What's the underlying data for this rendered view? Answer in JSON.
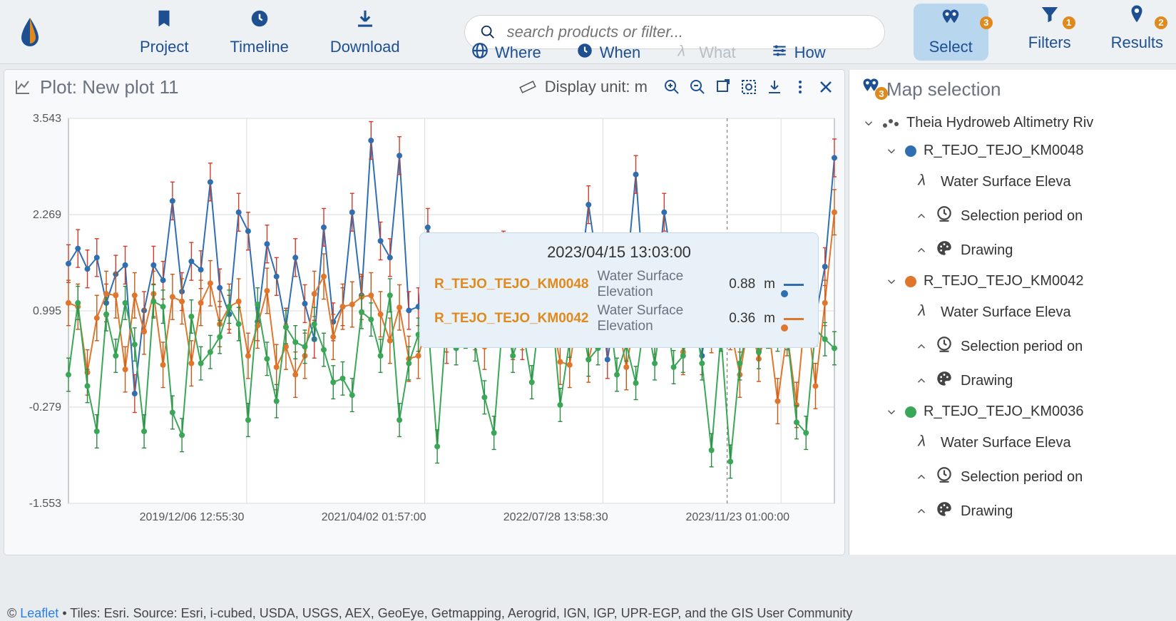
{
  "header": {
    "nav1": [
      {
        "icon": "bookmark",
        "label": "Project"
      },
      {
        "icon": "clock",
        "label": "Timeline"
      },
      {
        "icon": "download",
        "label": "Download"
      }
    ],
    "search_placeholder": "search products or filter...",
    "midtabs": [
      {
        "icon": "globe",
        "label": "Where",
        "muted": false
      },
      {
        "icon": "clock",
        "label": "When",
        "muted": false
      },
      {
        "icon": "lambda",
        "label": "What",
        "muted": true
      },
      {
        "icon": "sliders",
        "label": "How",
        "muted": false
      }
    ],
    "nav2": [
      {
        "icon": "pins",
        "label": "Select",
        "badge": 3,
        "active": true
      },
      {
        "icon": "funnel",
        "label": "Filters",
        "badge": 1,
        "active": false
      },
      {
        "icon": "pin",
        "label": "Results",
        "badge": 2,
        "active": false
      }
    ]
  },
  "plot": {
    "title": "Plot: New plot 11",
    "unit_label": "Display unit: m",
    "tooltip": {
      "time": "2023/04/15 13:03:00",
      "rows": [
        {
          "name": "R_TEJO_TEJO_KM0048",
          "var": "Water Surface Elevation",
          "val": "0.88",
          "unit": "m",
          "color": "#2f6fb1"
        },
        {
          "name": "R_TEJO_TEJO_KM0042",
          "var": "Water Surface Elevation",
          "val": "0.36",
          "unit": "m",
          "color": "#e0762c"
        }
      ]
    }
  },
  "side": {
    "title": "Map selection",
    "badge": 3,
    "group": "Theia Hydroweb Altimetry Riv",
    "stations": [
      {
        "name": "R_TEJO_TEJO_KM0048",
        "color": "#2f6fb1"
      },
      {
        "name": "R_TEJO_TEJO_KM0042",
        "color": "#e0762c"
      },
      {
        "name": "R_TEJO_TEJO_KM0036",
        "color": "#3aa757"
      }
    ],
    "sub": [
      "Water Surface Eleva",
      "Selection period on ",
      "Drawing"
    ]
  },
  "footer": {
    "leaflet": "Leaflet",
    "attr": " • Tiles: Esri. Source: Esri, i-cubed, USDA, USGS, AEX, GeoEye, Getmapping, Aerogrid, IGN, IGP, UPR-EGP, and the GIS User Community"
  },
  "chart_data": {
    "type": "line",
    "xlabel": "",
    "ylabel": "",
    "x_ticks": [
      "2019/12/06 12:55:30",
      "2021/04/02 01:57:00",
      "2022/07/28 13:58:30",
      "2023/11/23 01:00:00"
    ],
    "ylim": [
      -1.553,
      3.543
    ],
    "y_ticks": [
      -1.553,
      -0.279,
      0.995,
      2.269,
      3.543
    ],
    "x_range": [
      0,
      100
    ],
    "error_bars": true,
    "cursor_x": 86,
    "series": [
      {
        "name": "R_TEJO_TEJO_KM0048",
        "color": "#2f6fb1",
        "err": 0.25,
        "values": [
          1.62,
          1.82,
          1.55,
          1.7,
          1.1,
          1.48,
          1.6,
          -0.1,
          1.0,
          1.6,
          1.4,
          2.45,
          1.25,
          1.65,
          1.54,
          2.7,
          1.3,
          0.95,
          2.3,
          2.05,
          0.85,
          1.88,
          1.45,
          0.78,
          1.7,
          1.09,
          0.62,
          2.1,
          0.85,
          1.05,
          2.3,
          1.2,
          3.25,
          1.92,
          1.7,
          3.05,
          1.0,
          1.05,
          2.1,
          1.55,
          0.55,
          1.52,
          1.45,
          1.3,
          1.45,
          0.85,
          1.8,
          0.6,
          0.6,
          1.3,
          1.32,
          0.8,
          0.9,
          1.68,
          1.3,
          2.4,
          1.55,
          0.35,
          1.1,
          1.45,
          2.8,
          1.05,
          1.05,
          2.3,
          1.5,
          0.7,
          0.8,
          0.4,
          1.35,
          1.56,
          1.64,
          0.88,
          0.8,
          1.44,
          1.3,
          1.48,
          1.7,
          1.0,
          0.88,
          0.9,
          1.58,
          3.02
        ]
      },
      {
        "name": "R_TEJO_TEJO_KM0042",
        "color": "#e0762c",
        "err": 0.3,
        "values": [
          1.1,
          1.05,
          0.18,
          0.9,
          1.22,
          1.2,
          0.22,
          1.2,
          0.72,
          1.22,
          0.28,
          1.18,
          1.12,
          0.3,
          1.1,
          1.36,
          0.82,
          1.05,
          1.12,
          0.4,
          0.8,
          1.26,
          0.25,
          0.52,
          0.15,
          0.4,
          1.22,
          1.45,
          0.65,
          1.05,
          1.08,
          1.18,
          1.2,
          0.95,
          0.6,
          1.04,
          0.36,
          0.4,
          0.82,
          0.92,
          0.75,
          0.88,
          1.02,
          0.78,
          0.52,
          1.02,
          1.1,
          1.1,
          0.78,
          0.9,
          1.0,
          0.96,
          0.32,
          0.28,
          1.05,
          0.35,
          0.85,
          1.18,
          0.9,
          0.25,
          0.95,
          0.95,
          0.72,
          1.0,
          1.36,
          0.45,
          0.96,
          0.96,
          0.74,
          1.0,
          0.78,
          0.15,
          0.88,
          0.36,
          0.82,
          -0.2,
          0.7,
          -0.25,
          1.1,
          0.0,
          1.1,
          2.3
        ]
      },
      {
        "name": "R_TEJO_TEJO_KM0036",
        "color": "#3aa757",
        "err": 0.22,
        "values": [
          0.15,
          1.1,
          0.0,
          -0.6,
          0.95,
          0.4,
          1.1,
          0.55,
          -0.6,
          1.12,
          1.05,
          -0.35,
          -0.65,
          0.92,
          0.3,
          0.45,
          0.65,
          1.05,
          0.82,
          -0.45,
          1.08,
          0.36,
          -0.2,
          0.78,
          0.58,
          0.52,
          0.82,
          0.48,
          0.05,
          0.1,
          -0.12,
          0.98,
          0.88,
          0.4,
          1.2,
          -0.45,
          0.3,
          0.68,
          0.88,
          -0.8,
          0.9,
          0.5,
          0.72,
          0.55,
          -0.15,
          -0.62,
          1.0,
          0.4,
          0.78,
          0.05,
          1.15,
          1.2,
          -0.25,
          0.6,
          1.05,
          0.35,
          0.5,
          1.2,
          0.15,
          0.55,
          0.04,
          0.95,
          0.3,
          1.15,
          0.25,
          0.4,
          1.05,
          0.3,
          -0.85,
          0.68,
          -1.0,
          0.3,
          0.85,
          0.45,
          0.72,
          0.68,
          0.7,
          -0.48,
          -0.62,
          0.75,
          0.62,
          0.5
        ]
      }
    ]
  }
}
